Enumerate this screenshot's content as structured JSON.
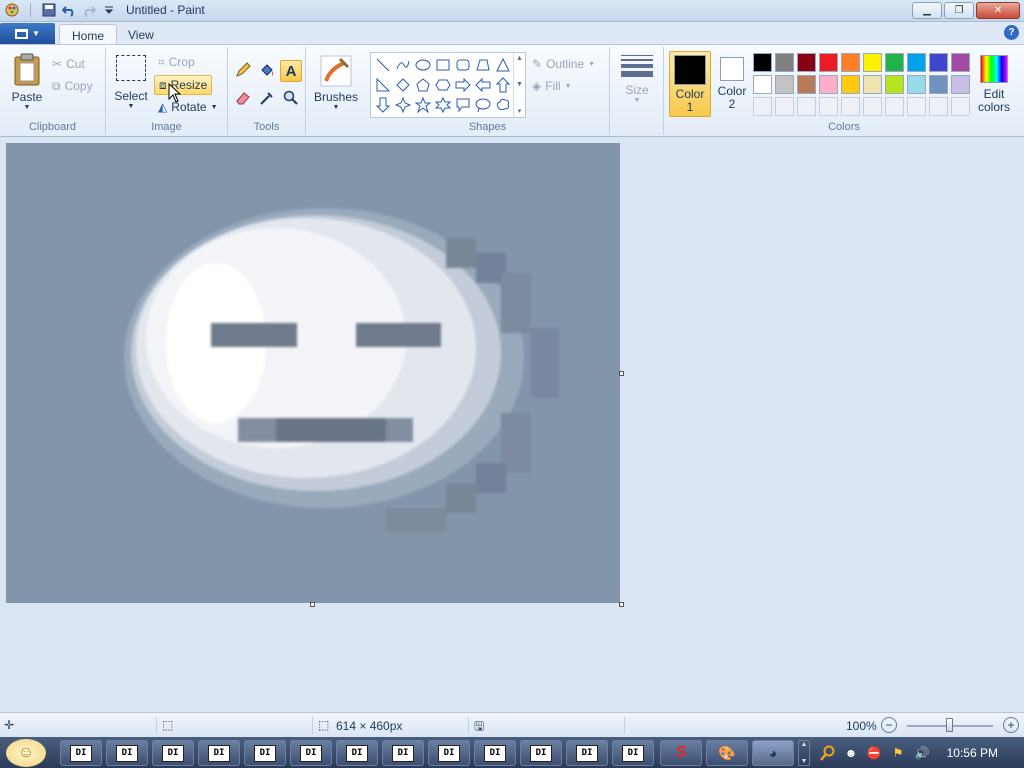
{
  "window": {
    "title": "Untitled - Paint"
  },
  "tabs": [
    {
      "label": "Home"
    },
    {
      "label": "View"
    }
  ],
  "clipboard": {
    "paste": "Paste",
    "cut": "Cut",
    "copy": "Copy",
    "group": "Clipboard"
  },
  "image": {
    "select": "Select",
    "crop": "Crop",
    "resize": "Resize",
    "rotate": "Rotate",
    "group": "Image"
  },
  "tools": {
    "group": "Tools"
  },
  "brushes": {
    "label": "Brushes"
  },
  "shapes": {
    "outline": "Outline",
    "fill": "Fill",
    "group": "Shapes"
  },
  "size": {
    "label": "Size"
  },
  "colors": {
    "color1_line1": "Color",
    "color1_line2": "1",
    "color2_line1": "Color",
    "color2_line2": "2",
    "edit_line1": "Edit",
    "edit_line2": "colors",
    "group": "Colors",
    "color1_value": "#000000",
    "color2_value": "#ffffff",
    "palette": [
      "#000000",
      "#7f7f7f",
      "#880015",
      "#ed1c24",
      "#ff7f27",
      "#fff200",
      "#22b14c",
      "#00a2e8",
      "#3f48cc",
      "#a349a4",
      "#ffffff",
      "#c3c3c3",
      "#b97a57",
      "#ffaec9",
      "#ffc90e",
      "#efe4b0",
      "#b5e61d",
      "#99d9ea",
      "#7092be",
      "#c8bfe7"
    ]
  },
  "status": {
    "dimensions": "614 × 460px",
    "zoom": "100%",
    "zoom_level": 0.5
  },
  "taskbar": {
    "clock": "10:56 PM",
    "app_label": "DI"
  }
}
